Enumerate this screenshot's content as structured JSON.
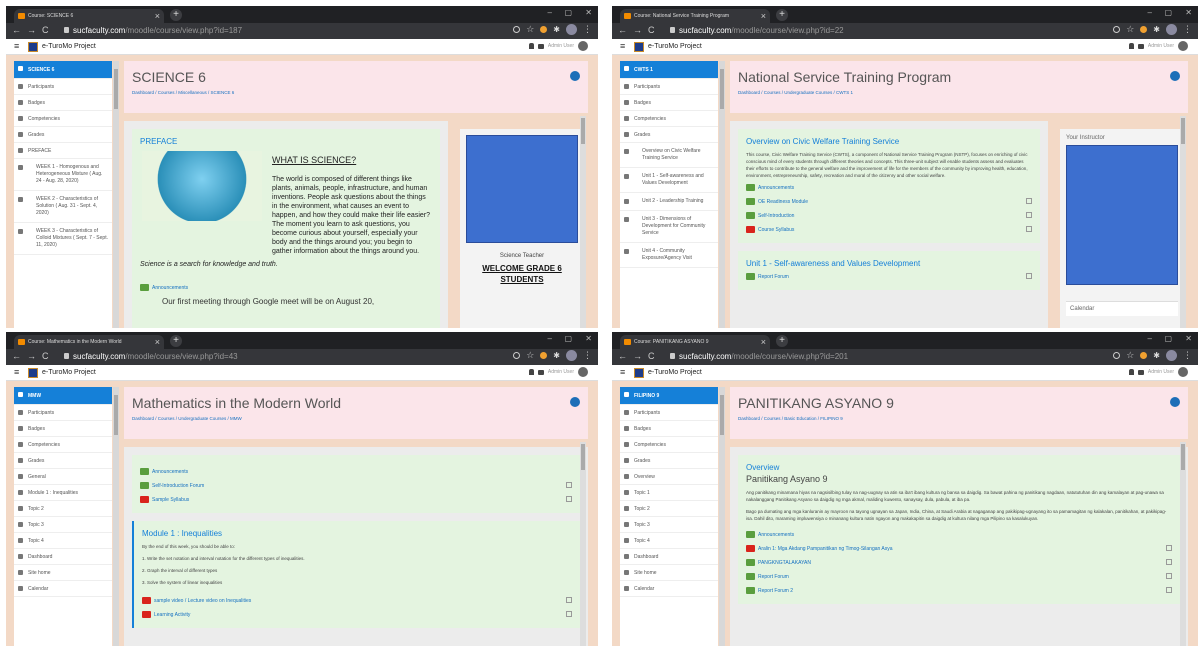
{
  "panes": [
    {
      "tab_title": "Course: SCIENCE 6",
      "url_host": "sucfaculty.com",
      "url_path": "/moodle/course/view.php?id=187",
      "brand": "e-TuroMo Project",
      "user_label": "Admin User",
      "sidebar": [
        {
          "label": "SCIENCE 6",
          "active": true
        },
        {
          "label": "Participants"
        },
        {
          "label": "Badges"
        },
        {
          "label": "Competencies"
        },
        {
          "label": "Grades"
        },
        {
          "label": "PREFACE"
        },
        {
          "label": "WEEK 1 - Homogenous and Heterogeneous Mixture ( Aug. 24 - Aug. 28, 2020)",
          "multi": true
        },
        {
          "label": "WEEK 2 - Characteristics of Solution ( Aug. 31 - Sept. 4, 2020)",
          "multi": true
        },
        {
          "label": "WEEK 3 - Characteristics of Colloid Mixtures ( Sept. 7 - Sept. 11, 2020)",
          "multi": true
        }
      ],
      "title": "SCIENCE 6",
      "breadcrumb": "Dashboard / Courses / Miscellaneous / SCIENCE 6",
      "section_title": "PREFACE",
      "science_heading": "WHAT IS SCIENCE?",
      "paragraph": "The world is composed of different things like plants, animals, people, infrastructure, and human inventions. People ask questions about the things in the environment, what causes an event to happen, and how they could make their life easier? The moment you learn to ask questions, you become curious about yourself, especially your body and the things around you; you begin to gather information about the things around you.",
      "italic_line": "Science is a search for knowledge and truth.",
      "announcements": "Announcements",
      "meeting": "Our first meeting through Google meet will be on August 20,",
      "teacher_label": "Science Teacher",
      "welcome": "WELCOME GRADE 6 STUDENTS"
    },
    {
      "tab_title": "Course: National Service Training Program",
      "url_host": "sucfaculty.com",
      "url_path": "/moodle/course/view.php?id=22",
      "brand": "e-TuroMo Project",
      "user_label": "Admin User",
      "sidebar": [
        {
          "label": "CWTS 1",
          "active": true
        },
        {
          "label": "Participants"
        },
        {
          "label": "Badges"
        },
        {
          "label": "Competencies"
        },
        {
          "label": "Grades"
        },
        {
          "label": "Overview on Civic Welfare Training Service",
          "multi": true
        },
        {
          "label": "Unit 1 - Self-awareness and Values Development",
          "multi": true
        },
        {
          "label": "Unit 2 - Leadership Training",
          "multi": true
        },
        {
          "label": "Unit 3 - Dimensions of Development for Community Service",
          "multi": true
        },
        {
          "label": "Unit 4 - Community Exposure/Agency Visit",
          "multi": true
        }
      ],
      "title": "National Service Training Program",
      "breadcrumb": "Dashboard / Courses / Undergraduate Courses / CWTS 1",
      "section_title": "Overview on Civic Welfare Training Service",
      "paragraph": "This course, Civic Welfare Training Service (CWTS), a component of National Service Training Program (NSTP), focuses on enriching of civic conscious mind of every students through different theories and concepts. This three-unit subject will enable students assess and evaluates their efforts to contribute to the general welfare and the improvement of life for the members of the community by improving health, education, environment, entrepreneurship, safety, recreation and moral of the citizenry and other social welfare.",
      "activities": [
        {
          "label": "Announcements",
          "type": "forum",
          "check": false
        },
        {
          "label": "OE Readiness Module",
          "type": "forum",
          "check": true
        },
        {
          "label": "Self-Introduction",
          "type": "forum",
          "check": true
        },
        {
          "label": "Course Syllabus",
          "type": "pdf",
          "check": true
        }
      ],
      "section2": "Unit 1 - Self-awareness and Values Development",
      "section2_activity": "Report Forum",
      "instructor": "Your Instructor",
      "calendar": "Calendar"
    },
    {
      "tab_title": "Course: Mathematics in the Modern World",
      "url_host": "sucfaculty.com",
      "url_path": "/moodle/course/view.php?id=43",
      "brand": "e-TuroMo Project",
      "user_label": "Admin User",
      "sidebar": [
        {
          "label": "MMW",
          "active": true
        },
        {
          "label": "Participants"
        },
        {
          "label": "Badges"
        },
        {
          "label": "Competencies"
        },
        {
          "label": "Grades"
        },
        {
          "label": "General"
        },
        {
          "label": "Module 1 : Inequalities"
        },
        {
          "label": "Topic 2"
        },
        {
          "label": "Topic 3"
        },
        {
          "label": "Topic 4"
        },
        {
          "label": "Dashboard"
        },
        {
          "label": "Site home"
        },
        {
          "label": "Calendar"
        }
      ],
      "title": "Mathematics in the Modern World",
      "breadcrumb": "Dashboard / Courses / Undergraduate Courses / MMW",
      "activities": [
        {
          "label": "Announcements",
          "type": "forum",
          "check": false
        },
        {
          "label": "Self-Introduction Forum",
          "type": "forum",
          "check": true
        },
        {
          "label": "Sample Syllabus",
          "type": "pdf",
          "check": true
        }
      ],
      "section2": "Module 1 : Inequalities",
      "intro": "By the end of this week, you should be able to:",
      "objectives": [
        "1.   Write the set notation and interval notation for the different types of inequalities.",
        "2.   Graph the interval of different types",
        "3.   Solve the system of linear inequalities"
      ],
      "activities2": [
        {
          "label": "sample video / Lecture video on Inequalities",
          "type": "pdf",
          "check": true
        },
        {
          "label": "Learning Activity",
          "type": "pdf",
          "check": true
        }
      ]
    },
    {
      "tab_title": "Course: PANITIKANG ASYANO 9",
      "url_host": "sucfaculty.com",
      "url_path": "/moodle/course/view.php?id=201",
      "brand": "e-TuroMo Project",
      "user_label": "Admin User",
      "sidebar": [
        {
          "label": "FILIPINO 9",
          "active": true
        },
        {
          "label": "Participants"
        },
        {
          "label": "Badges"
        },
        {
          "label": "Competencies"
        },
        {
          "label": "Grades"
        },
        {
          "label": "Overview"
        },
        {
          "label": "Topic 1"
        },
        {
          "label": "Topic 2"
        },
        {
          "label": "Topic 3"
        },
        {
          "label": "Topic 4"
        },
        {
          "label": "Dashboard"
        },
        {
          "label": "Site home"
        },
        {
          "label": "Calendar"
        }
      ],
      "title": "PANITIKANG ASYANO 9",
      "breadcrumb": "Dashboard / Courses / Basic Education / FILIPINO 9",
      "section_title": "Overview",
      "subtitle": "Panitikang Asyano 9",
      "paragraph": "Ang panitikang minamana hiyas na nagsisilbing tulay na nag-uugnay sa atin sa iba't ibang kultura ng bansa sa daigdig. Sa bawat pahina ng panitikang nagdaan, natututuhan din ang kamalayan at pag-unawa sa nakalanggang Panitikang Asyano sa daigdig ng mga akmal, maliding kuwento, sanaysay, dula, pabula, at iba pa.",
      "paragraph2": "Bago pa dumating ang mga kanluranin ay mayroon na tayong ugnayan sa Japan, India, China, at Saudi Arabia at nagaganap ang pakikipag-ugnayang ito sa pamamagitan ng kalakalan, panitikahan, at pakikipag-isa. Dahil dito, maraming impluwensiya o minanang kultura natin ngayon ang makakapitin sa daigdig at kultura nilang mga Pilipino sa kasalukuyan.",
      "activities": [
        {
          "label": "Announcements",
          "type": "forum",
          "check": false
        },
        {
          "label": "Aralin 1: Mga Akdang Pampanitikan ng Timog-Silangan Asya",
          "type": "pdf",
          "check": true
        },
        {
          "label": "PANGKNGTALAKAYAN",
          "type": "forum",
          "check": true
        },
        {
          "label": "Report Forum",
          "type": "forum",
          "check": true
        },
        {
          "label": "Report Forum 2",
          "type": "forum",
          "check": true
        }
      ]
    }
  ]
}
